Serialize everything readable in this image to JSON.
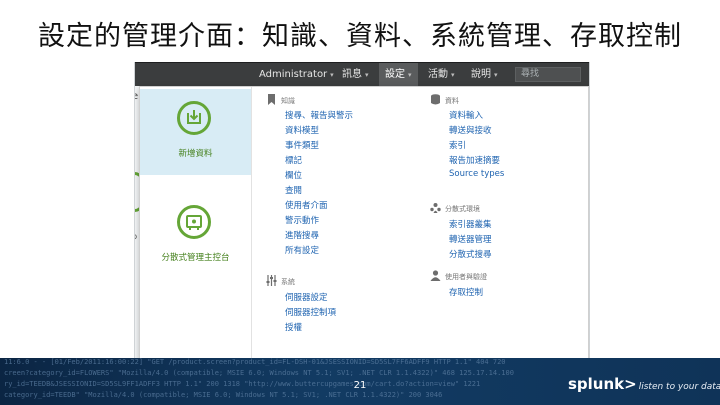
{
  "slide": {
    "title": "設定的管理介面：知識、資料、系統管理、存取控制",
    "page_number": "21"
  },
  "topbar": {
    "user_menu": "Administrator",
    "messages_menu": "訊息",
    "settings_menu": "設定",
    "activity_menu": "活動",
    "help_menu": "說明",
    "search_placeholder": "尋找",
    "caret": "▾"
  },
  "background": {
    "fragment_e": "e",
    "fragment_sp": "p"
  },
  "left_panel": {
    "tiles": [
      {
        "label": "新增資料",
        "icon": "add-data-icon",
        "selected": true
      },
      {
        "label": "分散式管理主控台",
        "icon": "distributed-management-icon",
        "selected": false
      }
    ]
  },
  "menu": {
    "knowledge": {
      "title": "知識",
      "icon": "bookmark-icon",
      "items": [
        "搜尋、報告與警示",
        "資料模型",
        "事件類型",
        "標記",
        "欄位",
        "查閱",
        "使用者介面",
        "警示動作",
        "進階搜尋",
        "所有設定"
      ]
    },
    "system": {
      "title": "系統",
      "icon": "sliders-icon",
      "items": [
        "伺服器設定",
        "伺服器控制項",
        "授權"
      ]
    },
    "data": {
      "title": "資料",
      "icon": "database-icon",
      "items": [
        "資料輸入",
        "轉送與接收",
        "索引",
        "報告加速摘要",
        "Source types"
      ]
    },
    "distributed": {
      "title": "分散式環境",
      "icon": "people-icon",
      "items": [
        "索引器叢集",
        "轉送器管理",
        "分散式搜尋"
      ]
    },
    "users": {
      "title": "使用者與驗證",
      "icon": "user-icon",
      "items": [
        "存取控制"
      ]
    }
  },
  "footer": {
    "brand": "splunk>",
    "tagline": "listen to your data",
    "log_lines": [
      "11:6.0 - - [01/Feb/2011:16:00:22] \"GET /product.screen?product_id=FL-DSH-01&JSESSIONID=SD5SL7FF6ADFF9 HTTP 1.1\" 404 720",
      "creen?category_id=FLOWERS\" \"Mozilla/4.0 (compatible; MSIE 6.0; Windows NT 5.1; SV1; .NET CLR 1.1.4322)\" 468 125.17.14.100",
      "ry_id=TEEDB&JSESSIONID=SD5SL9FF1ADFF3 HTTP 1.1\" 200 1318 \"http://www.buttercupgames.com/cart.do?action=view\" 1221",
      "category_id=TEEDB\" \"Mozilla/4.0 (compatible; MSIE 6.0; Windows NT 5.1; SV1; .NET CLR 1.1.4322)\" 200 3046"
    ]
  },
  "colors": {
    "accent_green": "#65a637",
    "link_blue": "#1e63b0",
    "topbar_bg": "#3b3d3e",
    "selected_tile_bg": "#d8ecf5",
    "footer_navy": "#0b2543"
  }
}
